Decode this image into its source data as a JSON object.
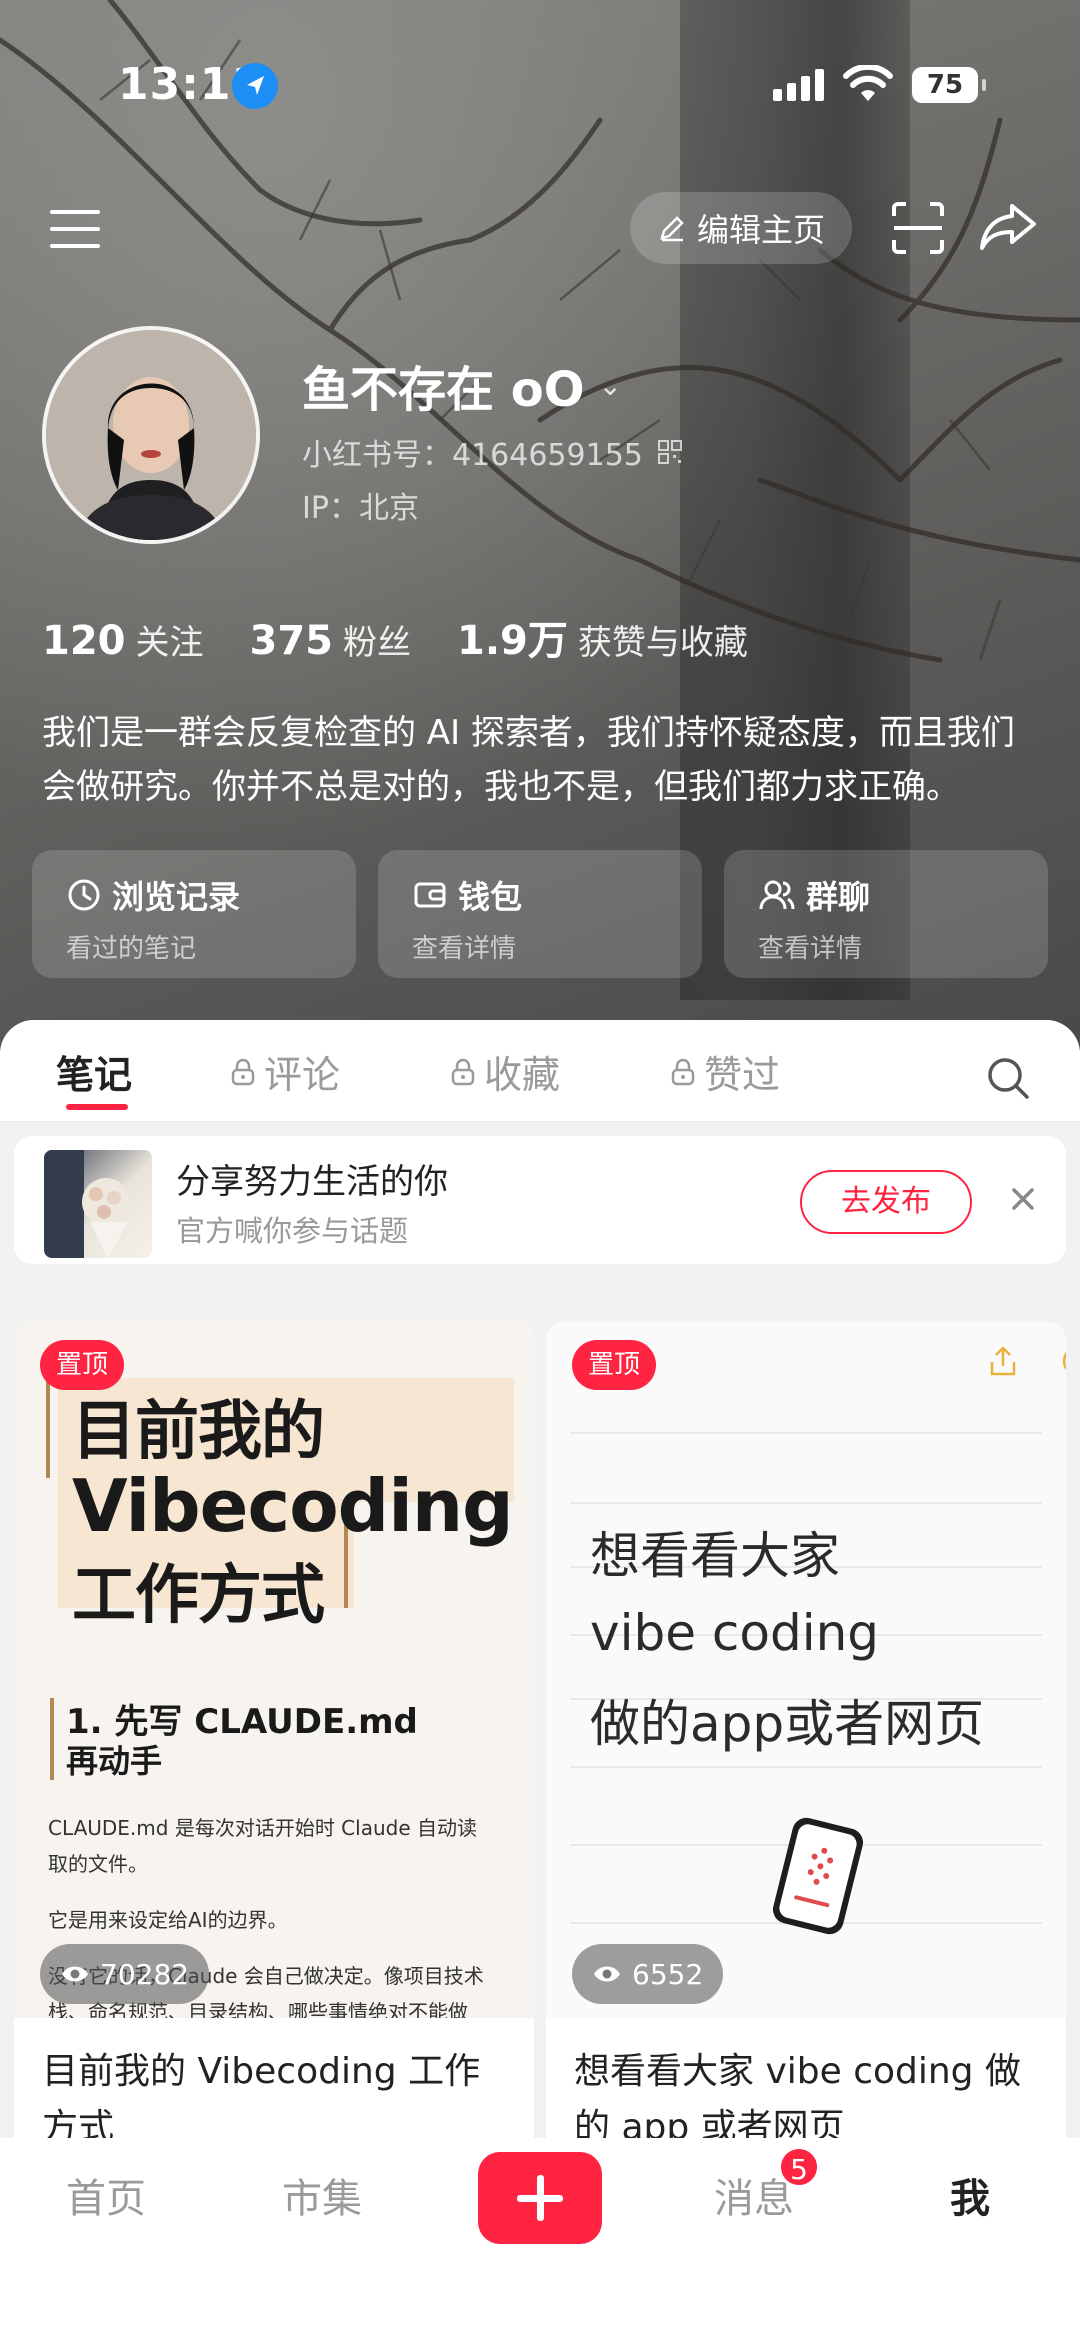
{
  "status_bar": {
    "time": "13:11",
    "battery": "75"
  },
  "header": {
    "edit_label": "编辑主页"
  },
  "profile": {
    "nickname": "鱼不存在 oO",
    "red_id": "小红书号：4164659155",
    "ip": "IP：北京",
    "stats": [
      {
        "value": "120",
        "label": "关注"
      },
      {
        "value": "375",
        "label": "粉丝"
      },
      {
        "value": "1.9万",
        "label": "获赞与收藏"
      }
    ],
    "bio_line1": "我们是一群会反复检查的 AI 探索者，我们持怀疑态度，而且我们",
    "bio_line2": "会做研究。你并不总是对的，我也不是，但我们都力求正确。"
  },
  "quick_actions": [
    {
      "title": "浏览记录",
      "sub": "看过的笔记",
      "icon": "clock-icon"
    },
    {
      "title": "钱包",
      "sub": "查看详情",
      "icon": "wallet-icon"
    },
    {
      "title": "群聊",
      "sub": "查看详情",
      "icon": "group-icon"
    }
  ],
  "tabs": [
    {
      "label": "笔记",
      "locked": false
    },
    {
      "label": "评论",
      "locked": true
    },
    {
      "label": "收藏",
      "locked": true
    },
    {
      "label": "赞过",
      "locked": true
    }
  ],
  "banner": {
    "title": "分享努力生活的你",
    "sub": "官方喊你参与话题",
    "button": "去发布"
  },
  "notes": [
    {
      "pin": "置顶",
      "views": "70282",
      "title_line1": "目前我的 Vibecoding 工作",
      "title_line2": "方式",
      "cover": {
        "line1": "目前我的",
        "line2": "Vibecoding",
        "line3": "工作方式",
        "h2_line1": "1. 先写 CLAUDE.md",
        "h2_line2": "再动手",
        "p1_line1": "CLAUDE.md 是每次对话开始时 Claude 自动读",
        "p1_line2": "取的文件。",
        "p2": "它是用来设定给AI的边界。",
        "p3_line1": "没有它的话，Claude 会自己做决定。像项目技术",
        "p3_line2": "栈、命名规范、目录结构、哪些事情绝对不能做"
      }
    },
    {
      "pin": "置顶",
      "views": "6552",
      "title_line1": "想看看大家 vibe coding 做",
      "title_line2": "的 app 或者网页",
      "cover": {
        "line1": "想看看大家",
        "line2": "vibe coding",
        "line3": "做的app或者网页"
      }
    }
  ],
  "bottom_nav": {
    "home": "首页",
    "market": "市集",
    "messages": "消息",
    "messages_badge": "5",
    "me": "我"
  },
  "colors": {
    "accent": "#ff2442"
  }
}
